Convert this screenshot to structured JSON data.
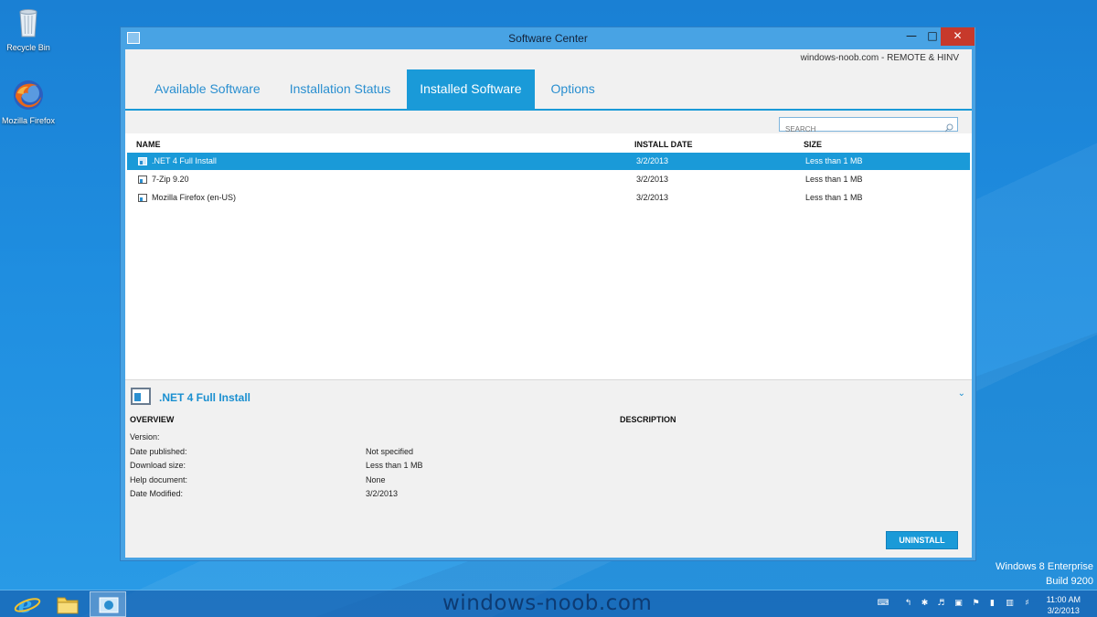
{
  "desktop": {
    "icons": [
      {
        "label": "Recycle Bin"
      },
      {
        "label": "Mozilla Firefox"
      }
    ],
    "edition_line1": "Windows 8 Enterprise",
    "edition_line2": "Build 9200"
  },
  "window": {
    "title": "Software Center",
    "remote_text": "windows-noob.com - REMOTE & HINV",
    "tabs": [
      {
        "label": "Available Software",
        "active": false
      },
      {
        "label": "Installation Status",
        "active": false
      },
      {
        "label": "Installed Software",
        "active": true
      },
      {
        "label": "Options",
        "active": false
      }
    ],
    "search": {
      "placeholder": "SEARCH"
    },
    "columns": {
      "name": "NAME",
      "install_date": "INSTALL DATE",
      "size": "SIZE"
    },
    "rows": [
      {
        "name": ".NET 4 Full Install",
        "install_date": "3/2/2013",
        "size": "Less than 1 MB",
        "selected": true
      },
      {
        "name": "7-Zip 9.20",
        "install_date": "3/2/2013",
        "size": "Less than 1 MB",
        "selected": false
      },
      {
        "name": "Mozilla Firefox (en-US)",
        "install_date": "3/2/2013",
        "size": "Less than 1 MB",
        "selected": false
      }
    ],
    "detail": {
      "title": ".NET 4 Full Install",
      "overview_heading": "OVERVIEW",
      "description_heading": "DESCRIPTION",
      "fields": [
        {
          "label": "Version:",
          "value": ""
        },
        {
          "label": "Date published:",
          "value": "Not specified"
        },
        {
          "label": "Download size:",
          "value": "Less than 1 MB"
        },
        {
          "label": "Help document:",
          "value": "None"
        },
        {
          "label": "Date Modified:",
          "value": "3/2/2013"
        }
      ],
      "uninstall_label": "UNINSTALL"
    }
  },
  "taskbar": {
    "watermark": "windows-noob.com",
    "time": "11:00 AM",
    "date": "3/2/2013"
  },
  "colors": {
    "accent": "#1a9ad8",
    "close": "#c7392b",
    "desktop": "#1f8ee0"
  }
}
